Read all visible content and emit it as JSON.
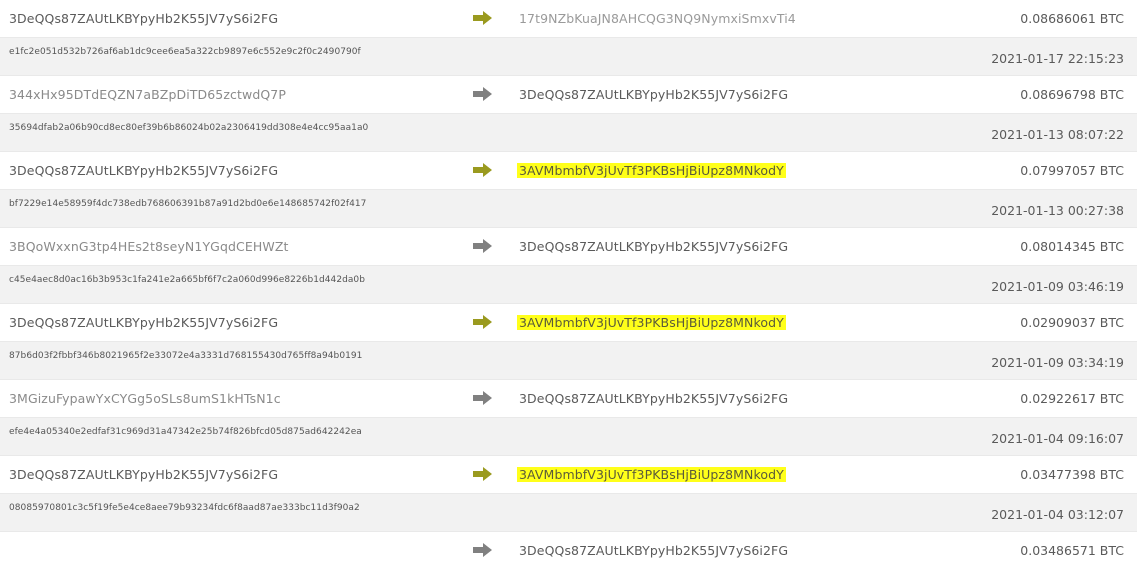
{
  "transactions": [
    {
      "from": "3DeQQs87ZAUtLKBYpyHb2K55JV7yS6i2FG",
      "to": "17t9NZbKuaJN8AHCQG3NQ9NymxiSmxvTi4",
      "amount": "0.08686061 BTC",
      "txid": "e1fc2e051d532b726af6ab1dc9cee6ea5a322cb9897e6c552e9c2f0c2490790f",
      "time": "2021-01-17 22:15:23",
      "arrow_color": "#9a9a1f",
      "highlighted": false
    },
    {
      "from": "344xHx95DTdEQZN7aBZpDiTD65zctwdQ7P",
      "to": "3DeQQs87ZAUtLKBYpyHb2K55JV7yS6i2FG",
      "amount": "0.08696798 BTC",
      "txid": "35694dfab2a06b90cd8ec80ef39b6b86024b02a2306419dd308e4e4cc95aa1a0",
      "time": "2021-01-13 08:07:22",
      "arrow_color": "#808080",
      "highlighted": false
    },
    {
      "from": "3DeQQs87ZAUtLKBYpyHb2K55JV7yS6i2FG",
      "to": "3AVMbmbfV3jUvTf3PKBsHjBiUpz8MNkodY",
      "amount": "0.07997057 BTC",
      "txid": "bf7229e14e58959f4dc738edb768606391b87a91d2bd0e6e148685742f02f417",
      "time": "2021-01-13 00:27:38",
      "arrow_color": "#9a9a1f",
      "highlighted": true
    },
    {
      "from": "3BQoWxxnG3tp4HEs2t8seyN1YGqdCEHWZt",
      "to": "3DeQQs87ZAUtLKBYpyHb2K55JV7yS6i2FG",
      "amount": "0.08014345 BTC",
      "txid": "c45e4aec8d0ac16b3b953c1fa241e2a665bf6f7c2a060d996e8226b1d442da0b",
      "time": "2021-01-09 03:46:19",
      "arrow_color": "#808080",
      "highlighted": false
    },
    {
      "from": "3DeQQs87ZAUtLKBYpyHb2K55JV7yS6i2FG",
      "to": "3AVMbmbfV3jUvTf3PKBsHjBiUpz8MNkodY",
      "amount": "0.02909037 BTC",
      "txid": "87b6d03f2fbbf346b8021965f2e33072e4a3331d768155430d765ff8a94b0191",
      "time": "2021-01-09 03:34:19",
      "arrow_color": "#9a9a1f",
      "highlighted": true
    },
    {
      "from": "3MGizuFypawYxCYGg5oSLs8umS1kHTsN1c",
      "to": "3DeQQs87ZAUtLKBYpyHb2K55JV7yS6i2FG",
      "amount": "0.02922617 BTC",
      "txid": "efe4e4a05340e2edfaf31c969d31a47342e25b74f826bfcd05d875ad642242ea",
      "time": "2021-01-04 09:16:07",
      "arrow_color": "#808080",
      "highlighted": false
    },
    {
      "from": "3DeQQs87ZAUtLKBYpyHb2K55JV7yS6i2FG",
      "to": "3AVMbmbfV3jUvTf3PKBsHjBiUpz8MNkodY",
      "amount": "0.03477398 BTC",
      "txid": "08085970801c3c5f19fe5e4ce8aee79b93234fdc6f8aad87ae333bc11d3f90a2",
      "time": "2021-01-04 03:12:07",
      "arrow_color": "#9a9a1f",
      "highlighted": true
    },
    {
      "from": "",
      "to": "3DeQQs87ZAUtLKBYpyHb2K55JV7yS6i2FG",
      "amount": "0.03486571 BTC",
      "txid": "",
      "time": "",
      "arrow_color": "#808080",
      "highlighted": false
    }
  ],
  "icons": {
    "arrow": "arrow-right-icon"
  },
  "colors": {
    "highlight": "#ffff1a",
    "outgoing_arrow": "#9a9a1f",
    "incoming_arrow": "#808080"
  }
}
